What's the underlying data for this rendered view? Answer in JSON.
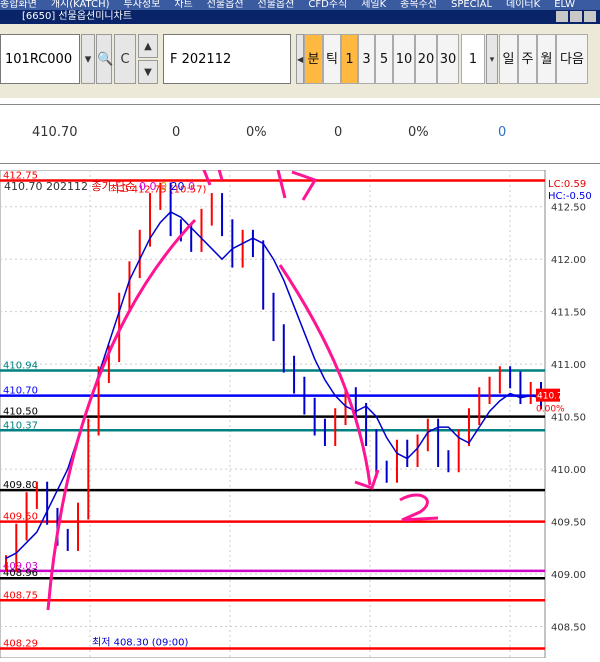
{
  "menu": [
    "종합화면",
    "개시(KATCH)",
    "투자정보",
    "차트",
    "선물옵션",
    "선물옵션",
    "CFD주식",
    "세일K",
    "종목주선",
    "SPECIAL",
    "데이터K",
    "ELW"
  ],
  "window": {
    "title": "[6650] 선물옵션미니차트"
  },
  "toolbar": {
    "code": "101RC000",
    "contract": "F 202112",
    "period_unit_active": "분",
    "period_unit_other": "틱",
    "periods": [
      "1",
      "3",
      "5",
      "10",
      "20",
      "30"
    ],
    "active_period": "1",
    "count": "1",
    "day_label": "일",
    "week_label": "주",
    "month_label": "월",
    "next_label": "다음"
  },
  "quote": {
    "price": "410.70",
    "change": "0",
    "change_pct": "0%",
    "volume": "0",
    "vol_pct": "0%",
    "oi": "0"
  },
  "chart_info": {
    "code": "410.70",
    "contract": "202112",
    "label1": "종가",
    "label2": "단순",
    "n1": "0",
    "n2": "0",
    "n3": "0",
    "n4": "20",
    "n5": "0"
  },
  "lc_label": "LC:0.59",
  "hc_label": "HC:-0.50",
  "chart_data": {
    "type": "line",
    "title": "",
    "xlabel": "",
    "ylabel": "",
    "ylim": [
      408.2,
      412.85
    ],
    "y_ticks": [
      "412.50",
      "412.00",
      "411.50",
      "411.00",
      "410.50",
      "410.00",
      "409.50",
      "409.00",
      "408.50"
    ],
    "current_price": "410.70",
    "current_change": "0.00%",
    "high_label": "최고 412.75 (10:57)",
    "low_label": "최저 408.30 (09:00)",
    "ma_values": [
      409.15,
      409.2,
      409.3,
      409.4,
      409.6,
      409.8,
      410.0,
      410.3,
      410.6,
      410.9,
      411.2,
      411.5,
      411.8,
      412.0,
      412.2,
      412.35,
      412.45,
      412.4,
      412.3,
      412.2,
      412.1,
      412.0,
      412.1,
      412.15,
      412.2,
      412.15,
      412.0,
      411.8,
      411.55,
      411.3,
      411.05,
      410.85,
      410.7,
      410.6,
      410.55,
      410.6,
      410.5,
      410.3,
      410.15,
      410.1,
      410.2,
      410.35,
      410.4,
      410.4,
      410.3,
      410.25,
      410.4,
      410.55,
      410.65,
      410.72,
      410.68,
      410.7,
      410.68
    ],
    "price_values": [
      409.1,
      409.4,
      409.7,
      409.8,
      409.55,
      409.35,
      409.3,
      409.6,
      410.4,
      410.9,
      411.1,
      411.6,
      411.9,
      412.2,
      412.55,
      412.65,
      412.3,
      412.25,
      412.15,
      412.4,
      412.55,
      412.3,
      412.0,
      412.2,
      412.1,
      411.6,
      411.3,
      411.0,
      410.8,
      410.6,
      410.4,
      410.3,
      410.5,
      410.7,
      410.55,
      410.3,
      410.0,
      409.95,
      410.2,
      410.1,
      410.25,
      410.4,
      410.1,
      410.05,
      410.3,
      410.5,
      410.7,
      410.8,
      410.9,
      410.85,
      410.7,
      410.75,
      410.65
    ],
    "levels": [
      {
        "label": "412.75",
        "value": 412.75,
        "color": "#ff0000"
      },
      {
        "label": "410.94",
        "value": 410.94,
        "color": "#008080"
      },
      {
        "label": "410.70",
        "value": 410.7,
        "color": "#0000ff"
      },
      {
        "label": "410.50",
        "value": 410.5,
        "color": "#000000"
      },
      {
        "label": "410.37",
        "value": 410.37,
        "color": "#008080"
      },
      {
        "label": "409.80",
        "value": 409.8,
        "color": "#000000"
      },
      {
        "label": "409.50",
        "value": 409.5,
        "color": "#ff0000"
      },
      {
        "label": "409.03",
        "value": 409.03,
        "color": "#cc00cc"
      },
      {
        "label": "408.96",
        "value": 408.96,
        "color": "#000000"
      },
      {
        "label": "408.75",
        "value": 408.75,
        "color": "#ff0000"
      },
      {
        "label": "408.29",
        "value": 408.29,
        "color": "#ff0000"
      }
    ]
  },
  "colors": {
    "accent": "#ffb840",
    "ma": "#0000cc",
    "candle": "#ff0000",
    "annotation": "#ff1493"
  }
}
